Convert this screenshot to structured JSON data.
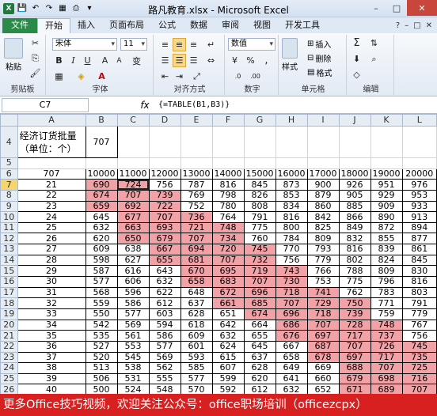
{
  "window": {
    "title": "路凡教育.xlsx - Microsoft Excel"
  },
  "tabs": [
    "文件",
    "开始",
    "插入",
    "页面布局",
    "公式",
    "数据",
    "审阅",
    "视图",
    "开发工具"
  ],
  "active_tab": "开始",
  "ribbon": {
    "paste_label": "粘贴",
    "font_name": "宋体",
    "font_size": "11",
    "number_format": "数值",
    "styles_label": "样式",
    "insert_label": "插入",
    "delete_label": "删除",
    "format_label": "格式",
    "groups": {
      "clipboard": "剪贴板",
      "font": "字体",
      "alignment": "对齐方式",
      "number": "数字",
      "cells": "单元格",
      "editing": "编辑"
    }
  },
  "formula_bar": {
    "name_box": "C7",
    "fx": "fx",
    "formula": "{=TABLE(B1,B3)}"
  },
  "sheet": {
    "columns": [
      "A",
      "B",
      "C",
      "D",
      "E",
      "F",
      "G",
      "H",
      "I",
      "J",
      "K",
      "L"
    ],
    "row_numbers": [
      "4",
      "5",
      "6",
      "7",
      "8",
      "9",
      "10",
      "11",
      "12",
      "13",
      "14",
      "15",
      "16",
      "17",
      "18",
      "19",
      "20",
      "21",
      "22",
      "23",
      "24",
      "25",
      "26"
    ],
    "label_cell": "经济订货批量（单位：个）",
    "label_value": "707",
    "header_row": [
      "707",
      "10000",
      "11000",
      "12000",
      "13000",
      "14000",
      "15000",
      "16000",
      "17000",
      "18000",
      "19000",
      "20000"
    ],
    "rows": [
      [
        "21",
        "690",
        "724",
        "756",
        "787",
        "816",
        "845",
        "873",
        "900",
        "926",
        "951",
        "976"
      ],
      [
        "22",
        "674",
        "707",
        "739",
        "769",
        "798",
        "826",
        "853",
        "879",
        "905",
        "929",
        "953"
      ],
      [
        "23",
        "659",
        "692",
        "722",
        "752",
        "780",
        "808",
        "834",
        "860",
        "885",
        "909",
        "933"
      ],
      [
        "24",
        "645",
        "677",
        "707",
        "736",
        "764",
        "791",
        "816",
        "842",
        "866",
        "890",
        "913"
      ],
      [
        "25",
        "632",
        "663",
        "693",
        "721",
        "748",
        "775",
        "800",
        "825",
        "849",
        "872",
        "894"
      ],
      [
        "26",
        "620",
        "650",
        "679",
        "707",
        "734",
        "760",
        "784",
        "809",
        "832",
        "855",
        "877"
      ],
      [
        "27",
        "609",
        "638",
        "667",
        "694",
        "720",
        "745",
        "770",
        "793",
        "816",
        "839",
        "861"
      ],
      [
        "28",
        "598",
        "627",
        "655",
        "681",
        "707",
        "732",
        "756",
        "779",
        "802",
        "824",
        "845"
      ],
      [
        "29",
        "587",
        "616",
        "643",
        "670",
        "695",
        "719",
        "743",
        "766",
        "788",
        "809",
        "830"
      ],
      [
        "30",
        "577",
        "606",
        "632",
        "658",
        "683",
        "707",
        "730",
        "753",
        "775",
        "796",
        "816"
      ],
      [
        "31",
        "568",
        "596",
        "622",
        "648",
        "672",
        "696",
        "718",
        "741",
        "762",
        "783",
        "803"
      ],
      [
        "32",
        "559",
        "586",
        "612",
        "637",
        "661",
        "685",
        "707",
        "729",
        "750",
        "771",
        "791"
      ],
      [
        "33",
        "550",
        "577",
        "603",
        "628",
        "651",
        "674",
        "696",
        "718",
        "739",
        "759",
        "779"
      ],
      [
        "34",
        "542",
        "569",
        "594",
        "618",
        "642",
        "664",
        "686",
        "707",
        "728",
        "748",
        "767"
      ],
      [
        "35",
        "535",
        "561",
        "586",
        "609",
        "632",
        "655",
        "676",
        "697",
        "717",
        "737",
        "756"
      ],
      [
        "36",
        "527",
        "553",
        "577",
        "601",
        "624",
        "645",
        "667",
        "687",
        "707",
        "726",
        "745"
      ],
      [
        "37",
        "520",
        "545",
        "569",
        "593",
        "615",
        "637",
        "658",
        "678",
        "697",
        "717",
        "735"
      ],
      [
        "38",
        "513",
        "538",
        "562",
        "585",
        "607",
        "628",
        "649",
        "669",
        "688",
        "707",
        "725"
      ],
      [
        "39",
        "506",
        "531",
        "555",
        "577",
        "599",
        "620",
        "641",
        "660",
        "679",
        "698",
        "716"
      ],
      [
        "40",
        "500",
        "524",
        "548",
        "570",
        "592",
        "612",
        "632",
        "652",
        "671",
        "689",
        "707"
      ]
    ],
    "pink_cells": [
      [
        0,
        1
      ],
      [
        0,
        2
      ],
      [
        1,
        1
      ],
      [
        1,
        2
      ],
      [
        1,
        3
      ],
      [
        2,
        1
      ],
      [
        2,
        2
      ],
      [
        2,
        3
      ],
      [
        3,
        2
      ],
      [
        3,
        3
      ],
      [
        3,
        4
      ],
      [
        4,
        2
      ],
      [
        4,
        3
      ],
      [
        4,
        4
      ],
      [
        4,
        5
      ],
      [
        5,
        2
      ],
      [
        5,
        3
      ],
      [
        5,
        4
      ],
      [
        5,
        5
      ],
      [
        6,
        3
      ],
      [
        6,
        4
      ],
      [
        6,
        5
      ],
      [
        6,
        6
      ],
      [
        7,
        3
      ],
      [
        7,
        4
      ],
      [
        7,
        5
      ],
      [
        7,
        6
      ],
      [
        8,
        4
      ],
      [
        8,
        5
      ],
      [
        8,
        6
      ],
      [
        8,
        7
      ],
      [
        9,
        4
      ],
      [
        9,
        5
      ],
      [
        9,
        6
      ],
      [
        9,
        7
      ],
      [
        10,
        5
      ],
      [
        10,
        6
      ],
      [
        10,
        7
      ],
      [
        10,
        8
      ],
      [
        11,
        5
      ],
      [
        11,
        6
      ],
      [
        11,
        7
      ],
      [
        11,
        8
      ],
      [
        11,
        9
      ],
      [
        12,
        6
      ],
      [
        12,
        7
      ],
      [
        12,
        8
      ],
      [
        12,
        9
      ],
      [
        13,
        7
      ],
      [
        13,
        8
      ],
      [
        13,
        9
      ],
      [
        13,
        10
      ],
      [
        14,
        7
      ],
      [
        14,
        8
      ],
      [
        14,
        9
      ],
      [
        14,
        10
      ],
      [
        15,
        8
      ],
      [
        15,
        9
      ],
      [
        15,
        10
      ],
      [
        15,
        11
      ],
      [
        16,
        8
      ],
      [
        16,
        9
      ],
      [
        16,
        10
      ],
      [
        16,
        11
      ],
      [
        17,
        9
      ],
      [
        17,
        10
      ],
      [
        17,
        11
      ],
      [
        18,
        9
      ],
      [
        18,
        10
      ],
      [
        18,
        11
      ],
      [
        19,
        9
      ],
      [
        19,
        10
      ],
      [
        19,
        11
      ]
    ]
  },
  "banner": "更多Office技巧视频，欢迎关注公众号：office职场培训（officezcpx）"
}
